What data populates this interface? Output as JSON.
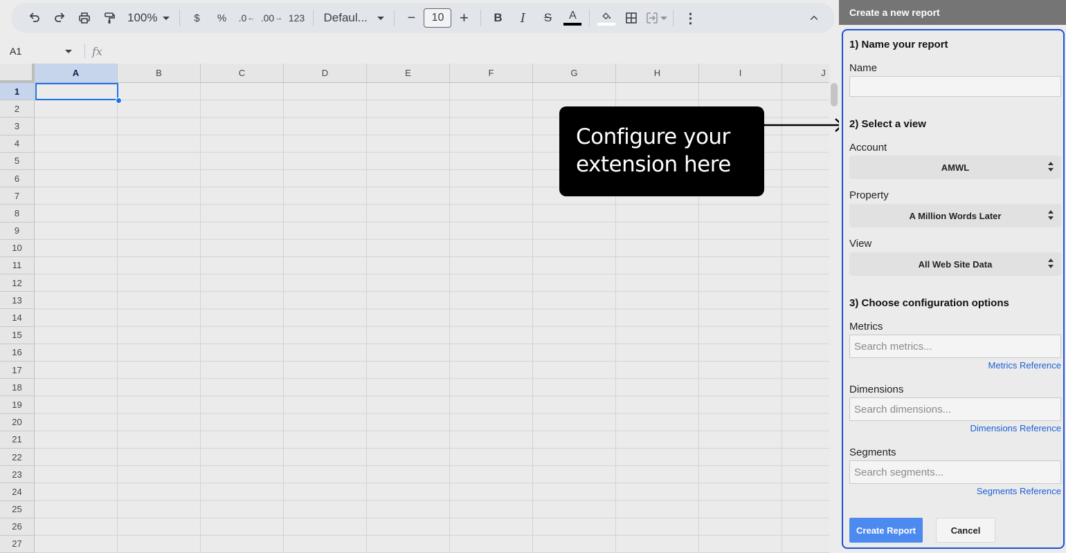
{
  "toolbar": {
    "zoom": "100%",
    "currency": "$",
    "percent": "%",
    "decrease_decimal": ".0",
    "increase_decimal": ".00",
    "number_format": "123",
    "font": "Defaul...",
    "font_size": "10",
    "bold": "B",
    "italic": "I",
    "text_color_letter": "A"
  },
  "formula_bar": {
    "cell_ref": "A1",
    "fx": "fx"
  },
  "grid": {
    "columns": [
      "A",
      "B",
      "C",
      "D",
      "E",
      "F",
      "G",
      "H",
      "I",
      "J"
    ],
    "rows": [
      "1",
      "2",
      "3",
      "4",
      "5",
      "6",
      "7",
      "8",
      "9",
      "10",
      "11",
      "12",
      "13",
      "14",
      "15",
      "16",
      "17",
      "18",
      "19",
      "20",
      "21",
      "22",
      "23",
      "24",
      "25",
      "26",
      "27"
    ],
    "selected_column": "A",
    "selected_row": "1"
  },
  "callout": {
    "line1": "Configure your",
    "line2": "extension here"
  },
  "sidebar": {
    "title": "Create a new report",
    "section1": "1) Name your report",
    "name_label": "Name",
    "name_value": "",
    "section2": "2) Select a view",
    "account_label": "Account",
    "account_value": "AMWL",
    "property_label": "Property",
    "property_value": "A Million Words Later",
    "view_label": "View",
    "view_value": "All Web Site Data",
    "section3": "3) Choose configuration options",
    "metrics_label": "Metrics",
    "metrics_placeholder": "Search metrics...",
    "metrics_link": "Metrics Reference",
    "dimensions_label": "Dimensions",
    "dimensions_placeholder": "Search dimensions...",
    "dimensions_link": "Dimensions Reference",
    "segments_label": "Segments",
    "segments_placeholder": "Search segments...",
    "segments_link": "Segments Reference",
    "create_button": "Create Report",
    "cancel_button": "Cancel"
  },
  "colors": {
    "accent": "#1a73e8",
    "panel_border": "#1a4fd6",
    "primary_button": "#4d8af0",
    "link": "#1a5fd6"
  }
}
